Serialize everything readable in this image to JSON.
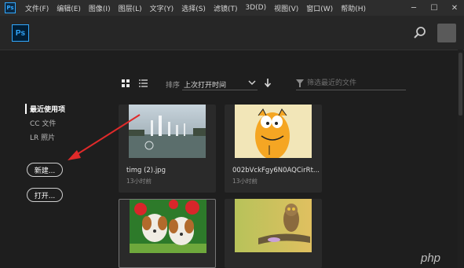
{
  "app": {
    "logo_text": "Ps",
    "small_logo_text": "Ps"
  },
  "menu": [
    "文件(F)",
    "编辑(E)",
    "图像(I)",
    "图层(L)",
    "文字(Y)",
    "选择(S)",
    "滤镜(T)",
    "3D(D)",
    "视图(V)",
    "窗口(W)",
    "帮助(H)"
  ],
  "window_controls": {
    "minimize": "─",
    "maximize": "☐",
    "close": "✕"
  },
  "sidebar": {
    "items": [
      {
        "label": "最近使用项",
        "active": true
      },
      {
        "label": "CC 文件",
        "active": false
      },
      {
        "label": "LR 照片",
        "active": false
      }
    ],
    "new_button": "新建...",
    "open_button": "打开..."
  },
  "toolbar": {
    "sort_label": "排序",
    "sort_value": "上次打开时间",
    "filter_placeholder": "筛选最近的文件"
  },
  "files": [
    {
      "name": "timg (2).jpg",
      "time": "13小时前",
      "thumb": "fountain-icon"
    },
    {
      "name": "002bVckFgy6N0AQCirRt...",
      "time": "13小时前",
      "thumb": "garfield-icon"
    },
    {
      "name": "",
      "time": "",
      "thumb": "puppies-icon"
    },
    {
      "name": "",
      "time": "",
      "thumb": "owl-icon"
    }
  ],
  "watermark": "php",
  "colors": {
    "accent": "#31a8ff",
    "annotation_arrow": "#e02a2a",
    "background": "#1e1e1e"
  }
}
